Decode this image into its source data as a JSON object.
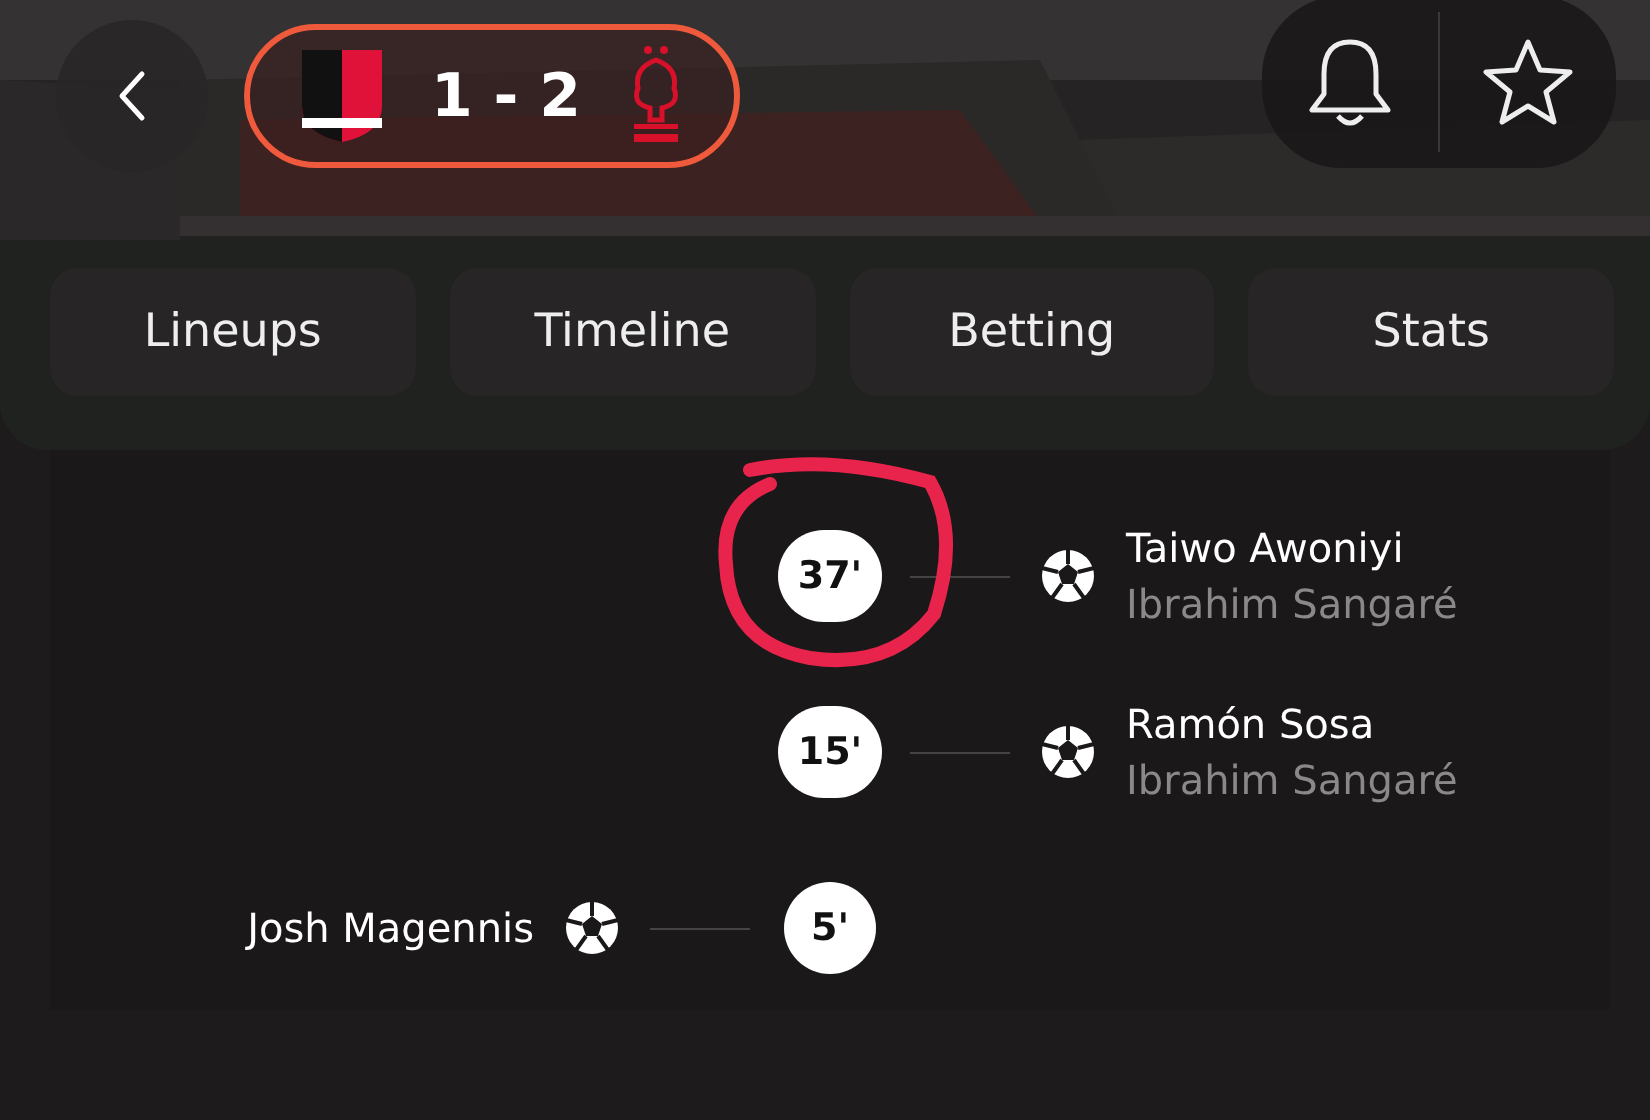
{
  "header": {
    "score": "1 - 2"
  },
  "tabs": [
    {
      "label": "Lineups",
      "selected": false
    },
    {
      "label": "Timeline",
      "selected": false
    },
    {
      "label": "Betting",
      "selected": false
    },
    {
      "label": "Stats",
      "selected": false
    }
  ],
  "events": [
    {
      "minute": "37'",
      "kind": "away",
      "player": "Taiwo Awoniyi",
      "assist": "Ibrahim Sangaré",
      "highlighted": true
    },
    {
      "minute": "15'",
      "kind": "away",
      "player": "Ramón Sosa",
      "assist": "Ibrahim Sangaré",
      "highlighted": false
    },
    {
      "minute": "5'",
      "kind": "home",
      "player": "Josh Magennis",
      "highlighted": false
    }
  ]
}
